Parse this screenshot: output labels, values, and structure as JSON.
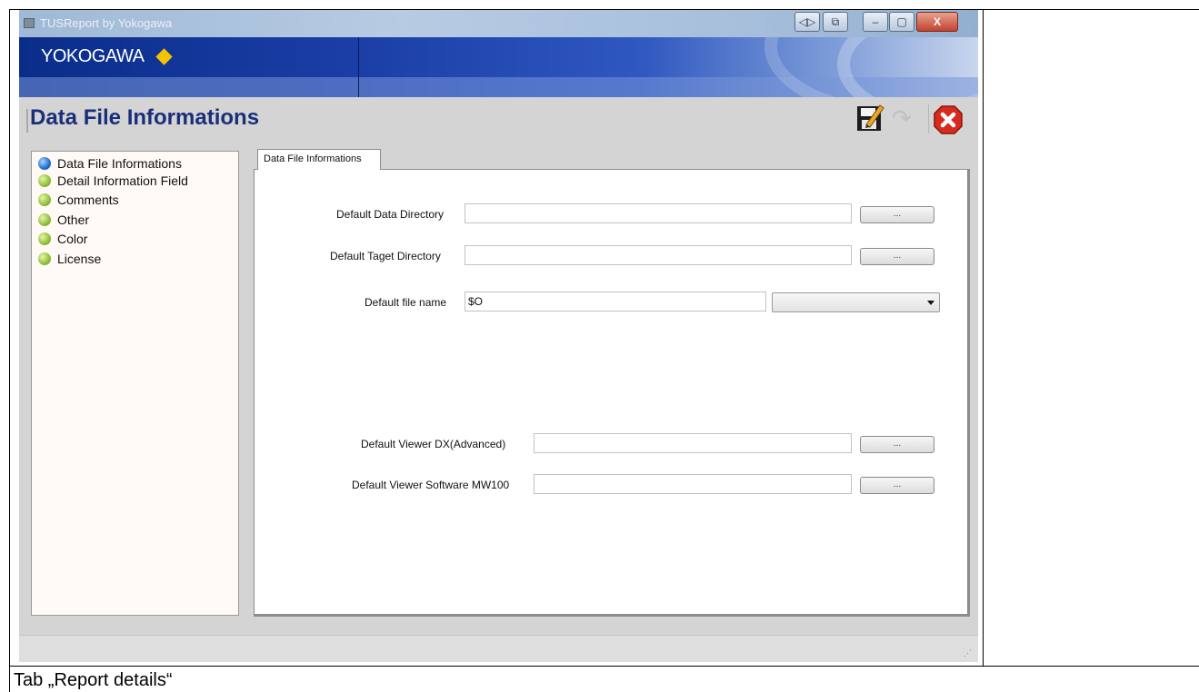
{
  "window": {
    "title": "TUSReport by Yokogawa",
    "controls": {
      "close": "X"
    }
  },
  "banner": {
    "logo": "YOKOGAWA"
  },
  "page": {
    "title": "Data File Informations"
  },
  "nav": {
    "items": [
      {
        "label": "Data File Informations",
        "active": true
      },
      {
        "label": "Detail Information Field",
        "active": false
      },
      {
        "label": "Comments",
        "active": false
      },
      {
        "label": "Other",
        "active": false
      },
      {
        "label": "Color",
        "active": false
      },
      {
        "label": "License",
        "active": false
      }
    ]
  },
  "tab": {
    "label": "Data File Informations"
  },
  "form": {
    "data_directory": {
      "label": "Default Data Directory",
      "value": "",
      "button": "..."
    },
    "target_directory": {
      "label": "Default Taget Directory",
      "value": "",
      "button": "..."
    },
    "file_name": {
      "label": "Default file name",
      "value": "$O",
      "select_value": ""
    },
    "viewer_dx": {
      "label": "Default Viewer DX(Advanced)",
      "value": "",
      "button": "..."
    },
    "viewer_mw100": {
      "label": "Default Viewer Software MW100",
      "value": "",
      "button": "..."
    }
  },
  "caption": "Tab „Report details“",
  "colors": {
    "banner": "#0a2d8a",
    "title": "#1a2e7a",
    "accent": "#f2c400"
  }
}
